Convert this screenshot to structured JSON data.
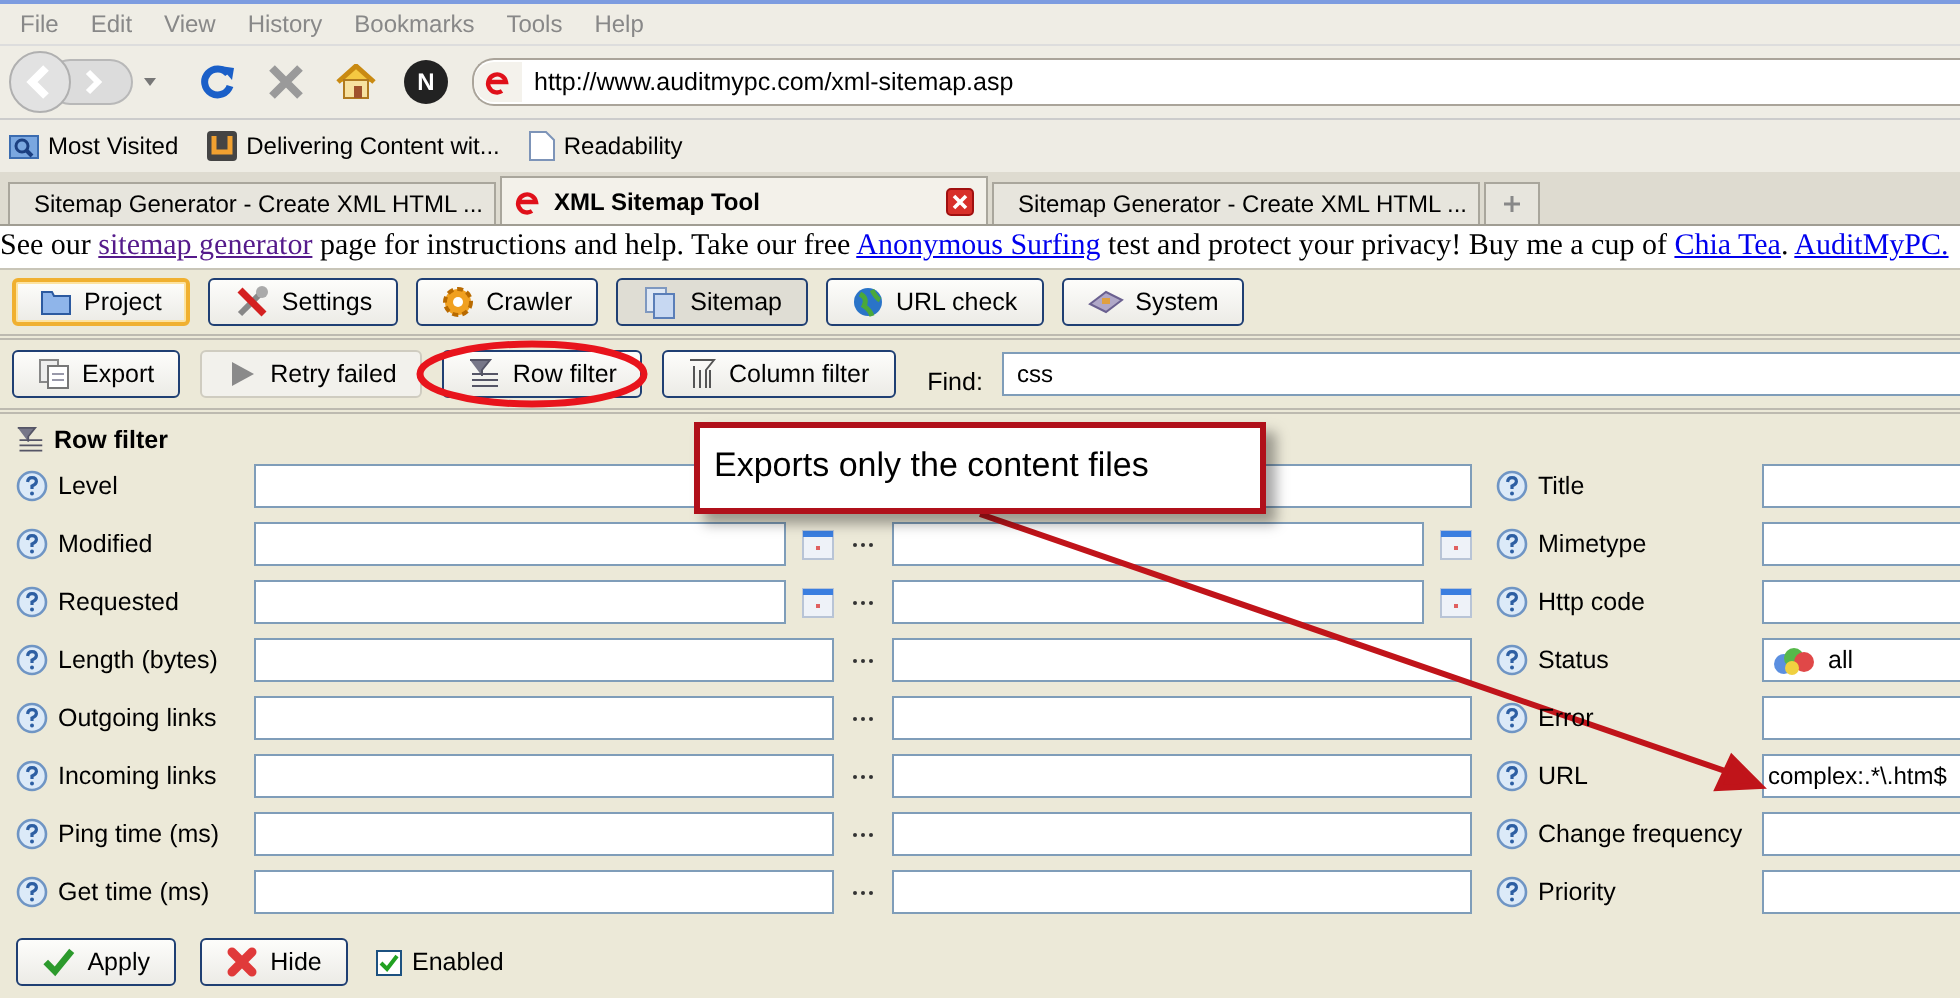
{
  "menu": [
    "File",
    "Edit",
    "View",
    "History",
    "Bookmarks",
    "Tools",
    "Help"
  ],
  "navigation": {
    "badge": "N",
    "address": "http://www.auditmypc.com/xml-sitemap.asp"
  },
  "bookmarks": [
    "Most Visited",
    "Delivering Content wit...",
    "Readability"
  ],
  "tabs": [
    {
      "label": "Sitemap Generator - Create XML HTML ...",
      "selected": false
    },
    {
      "label": "XML Sitemap Tool",
      "selected": true
    },
    {
      "label": "Sitemap Generator - Create XML HTML ...",
      "selected": false
    }
  ],
  "info_line": [
    {
      "kind": "text",
      "text": "See our "
    },
    {
      "kind": "visited_link",
      "text": "sitemap generator"
    },
    {
      "kind": "text",
      "text": " page for instructions and help. Take our free "
    },
    {
      "kind": "link",
      "text": "Anonymous Surfing"
    },
    {
      "kind": "text",
      "text": " test and protect your privacy! Buy me a cup of "
    },
    {
      "kind": "link",
      "text": "Chia Tea"
    },
    {
      "kind": "text",
      "text": ". "
    },
    {
      "kind": "link",
      "text": "AuditMyPC."
    }
  ],
  "main_toolbar": [
    {
      "label": "Project",
      "selected": false,
      "focused": true
    },
    {
      "label": "Settings",
      "selected": false,
      "focused": false
    },
    {
      "label": "Crawler",
      "selected": false,
      "focused": false
    },
    {
      "label": "Sitemap",
      "selected": true,
      "focused": false
    },
    {
      "label": "URL check",
      "selected": false,
      "focused": false
    },
    {
      "label": "System",
      "selected": false,
      "focused": false
    }
  ],
  "action_toolbar": {
    "buttons": [
      {
        "label": "Export",
        "disabled": false,
        "circled": false
      },
      {
        "label": "Retry failed",
        "disabled": true,
        "circled": false
      },
      {
        "label": "Row filter",
        "disabled": false,
        "circled": true
      },
      {
        "label": "Column filter",
        "disabled": false,
        "circled": false
      }
    ],
    "find_label": "Find:",
    "find_value": "css"
  },
  "row_filter": {
    "title": "Row filter",
    "left_rows": [
      {
        "label": "Level",
        "kind": "pair"
      },
      {
        "label": "Modified",
        "kind": "date_range"
      },
      {
        "label": "Requested",
        "kind": "date_range"
      },
      {
        "label": "Length (bytes)",
        "kind": "range"
      },
      {
        "label": "Outgoing links",
        "kind": "range"
      },
      {
        "label": "Incoming links",
        "kind": "range"
      },
      {
        "label": "Ping time (ms)",
        "kind": "range"
      },
      {
        "label": "Get time (ms)",
        "kind": "range"
      }
    ],
    "right_rows": [
      {
        "label": "Title",
        "kind": "text"
      },
      {
        "label": "Mimetype",
        "kind": "text"
      },
      {
        "label": "Http code",
        "kind": "text"
      },
      {
        "label": "Status",
        "kind": "dropdown",
        "value": "all"
      },
      {
        "label": "Error",
        "kind": "text"
      },
      {
        "label": "URL",
        "kind": "text",
        "value": "complex:.*\\.htm$"
      },
      {
        "label": "Change frequency",
        "kind": "text"
      },
      {
        "label": "Priority",
        "kind": "text"
      }
    ],
    "buttons": [
      {
        "label": "Apply",
        "kind": "apply"
      },
      {
        "label": "Hide",
        "kind": "hide"
      }
    ],
    "enabled": {
      "label": "Enabled",
      "checked": true
    }
  },
  "callout": {
    "text": "Exports only the content files"
  }
}
